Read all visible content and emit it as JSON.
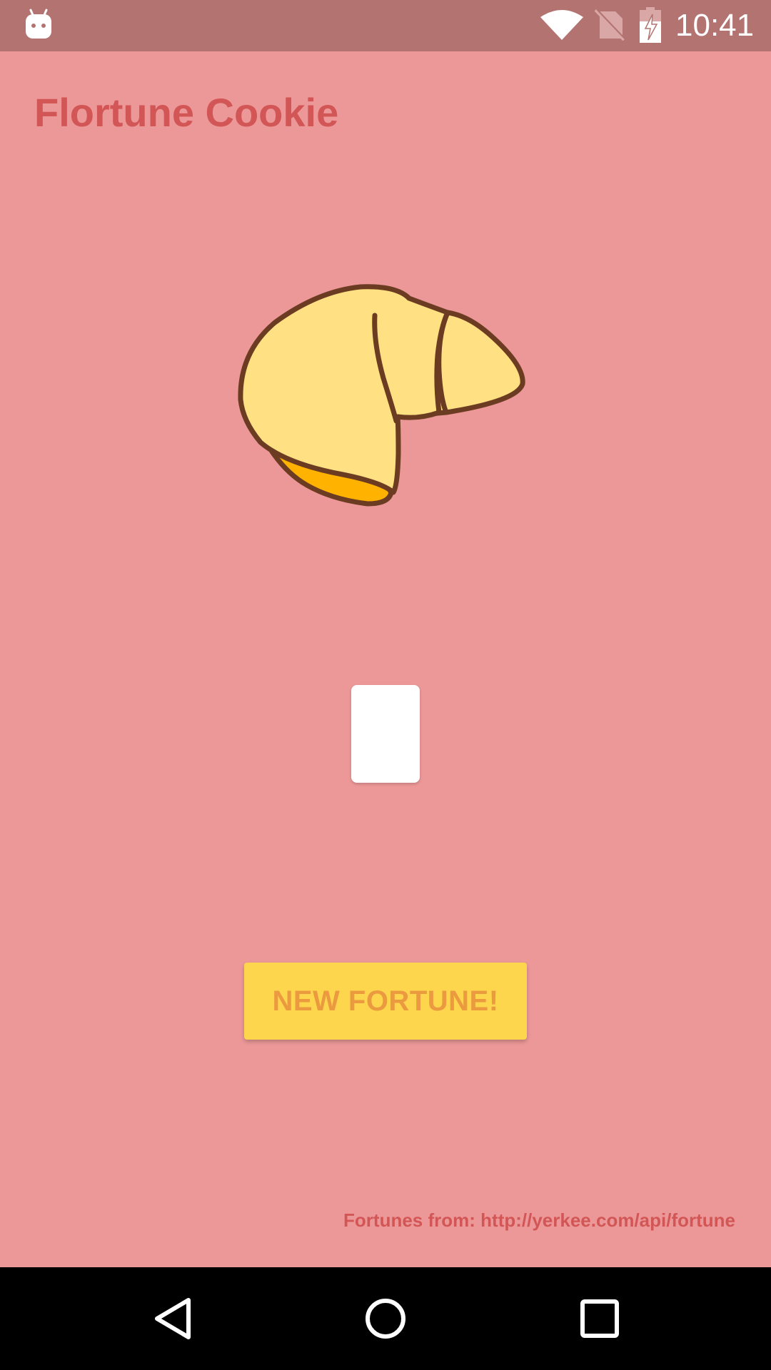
{
  "status_bar": {
    "time": "10:41",
    "icons": [
      "android-icon",
      "wifi-icon",
      "no-sim-icon",
      "battery-charging-icon"
    ]
  },
  "app": {
    "title": "Flortune Cookie"
  },
  "fortune": {
    "text": ""
  },
  "actions": {
    "new_fortune_label": "NEW FORTUNE!"
  },
  "footer": {
    "credit": "Fortunes from: http://yerkee.com/api/fortune"
  },
  "nav_bar": {
    "icons": [
      "back-icon",
      "home-icon",
      "recents-icon"
    ]
  },
  "colors": {
    "background": "#ED9898",
    "status_bar": "#B37371",
    "title": "#D25656",
    "button": "#FDD64E",
    "button_text": "#EC9A40",
    "cookie_fill": "#FFE082",
    "cookie_inner": "#FFB300",
    "cookie_outline": "#6B3B22"
  }
}
